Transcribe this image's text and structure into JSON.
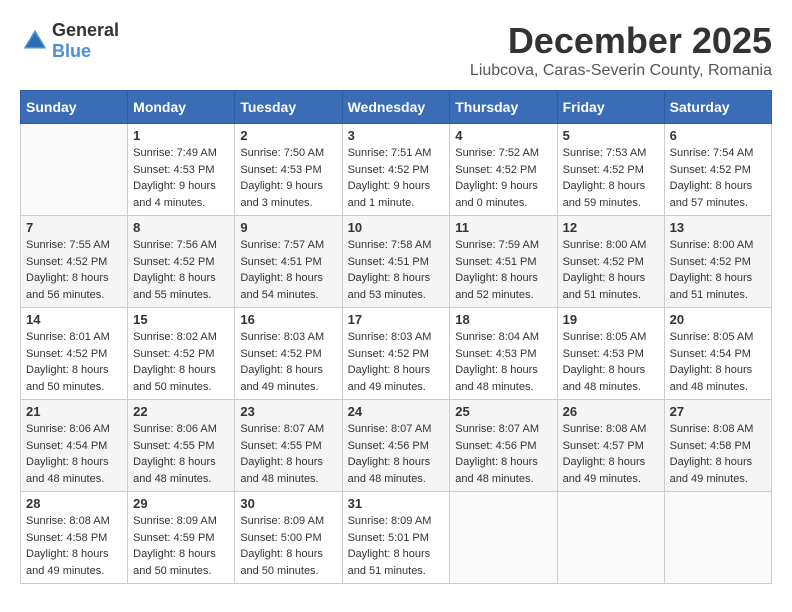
{
  "logo": {
    "text_general": "General",
    "text_blue": "Blue"
  },
  "header": {
    "month": "December 2025",
    "location": "Liubcova, Caras-Severin County, Romania"
  },
  "weekdays": [
    "Sunday",
    "Monday",
    "Tuesday",
    "Wednesday",
    "Thursday",
    "Friday",
    "Saturday"
  ],
  "weeks": [
    [
      {
        "day": "",
        "info": ""
      },
      {
        "day": "1",
        "info": "Sunrise: 7:49 AM\nSunset: 4:53 PM\nDaylight: 9 hours\nand 4 minutes."
      },
      {
        "day": "2",
        "info": "Sunrise: 7:50 AM\nSunset: 4:53 PM\nDaylight: 9 hours\nand 3 minutes."
      },
      {
        "day": "3",
        "info": "Sunrise: 7:51 AM\nSunset: 4:52 PM\nDaylight: 9 hours\nand 1 minute."
      },
      {
        "day": "4",
        "info": "Sunrise: 7:52 AM\nSunset: 4:52 PM\nDaylight: 9 hours\nand 0 minutes."
      },
      {
        "day": "5",
        "info": "Sunrise: 7:53 AM\nSunset: 4:52 PM\nDaylight: 8 hours\nand 59 minutes."
      },
      {
        "day": "6",
        "info": "Sunrise: 7:54 AM\nSunset: 4:52 PM\nDaylight: 8 hours\nand 57 minutes."
      }
    ],
    [
      {
        "day": "7",
        "info": "Sunrise: 7:55 AM\nSunset: 4:52 PM\nDaylight: 8 hours\nand 56 minutes."
      },
      {
        "day": "8",
        "info": "Sunrise: 7:56 AM\nSunset: 4:52 PM\nDaylight: 8 hours\nand 55 minutes."
      },
      {
        "day": "9",
        "info": "Sunrise: 7:57 AM\nSunset: 4:51 PM\nDaylight: 8 hours\nand 54 minutes."
      },
      {
        "day": "10",
        "info": "Sunrise: 7:58 AM\nSunset: 4:51 PM\nDaylight: 8 hours\nand 53 minutes."
      },
      {
        "day": "11",
        "info": "Sunrise: 7:59 AM\nSunset: 4:51 PM\nDaylight: 8 hours\nand 52 minutes."
      },
      {
        "day": "12",
        "info": "Sunrise: 8:00 AM\nSunset: 4:52 PM\nDaylight: 8 hours\nand 51 minutes."
      },
      {
        "day": "13",
        "info": "Sunrise: 8:00 AM\nSunset: 4:52 PM\nDaylight: 8 hours\nand 51 minutes."
      }
    ],
    [
      {
        "day": "14",
        "info": "Sunrise: 8:01 AM\nSunset: 4:52 PM\nDaylight: 8 hours\nand 50 minutes."
      },
      {
        "day": "15",
        "info": "Sunrise: 8:02 AM\nSunset: 4:52 PM\nDaylight: 8 hours\nand 50 minutes."
      },
      {
        "day": "16",
        "info": "Sunrise: 8:03 AM\nSunset: 4:52 PM\nDaylight: 8 hours\nand 49 minutes."
      },
      {
        "day": "17",
        "info": "Sunrise: 8:03 AM\nSunset: 4:52 PM\nDaylight: 8 hours\nand 49 minutes."
      },
      {
        "day": "18",
        "info": "Sunrise: 8:04 AM\nSunset: 4:53 PM\nDaylight: 8 hours\nand 48 minutes."
      },
      {
        "day": "19",
        "info": "Sunrise: 8:05 AM\nSunset: 4:53 PM\nDaylight: 8 hours\nand 48 minutes."
      },
      {
        "day": "20",
        "info": "Sunrise: 8:05 AM\nSunset: 4:54 PM\nDaylight: 8 hours\nand 48 minutes."
      }
    ],
    [
      {
        "day": "21",
        "info": "Sunrise: 8:06 AM\nSunset: 4:54 PM\nDaylight: 8 hours\nand 48 minutes."
      },
      {
        "day": "22",
        "info": "Sunrise: 8:06 AM\nSunset: 4:55 PM\nDaylight: 8 hours\nand 48 minutes."
      },
      {
        "day": "23",
        "info": "Sunrise: 8:07 AM\nSunset: 4:55 PM\nDaylight: 8 hours\nand 48 minutes."
      },
      {
        "day": "24",
        "info": "Sunrise: 8:07 AM\nSunset: 4:56 PM\nDaylight: 8 hours\nand 48 minutes."
      },
      {
        "day": "25",
        "info": "Sunrise: 8:07 AM\nSunset: 4:56 PM\nDaylight: 8 hours\nand 48 minutes."
      },
      {
        "day": "26",
        "info": "Sunrise: 8:08 AM\nSunset: 4:57 PM\nDaylight: 8 hours\nand 49 minutes."
      },
      {
        "day": "27",
        "info": "Sunrise: 8:08 AM\nSunset: 4:58 PM\nDaylight: 8 hours\nand 49 minutes."
      }
    ],
    [
      {
        "day": "28",
        "info": "Sunrise: 8:08 AM\nSunset: 4:58 PM\nDaylight: 8 hours\nand 49 minutes."
      },
      {
        "day": "29",
        "info": "Sunrise: 8:09 AM\nSunset: 4:59 PM\nDaylight: 8 hours\nand 50 minutes."
      },
      {
        "day": "30",
        "info": "Sunrise: 8:09 AM\nSunset: 5:00 PM\nDaylight: 8 hours\nand 50 minutes."
      },
      {
        "day": "31",
        "info": "Sunrise: 8:09 AM\nSunset: 5:01 PM\nDaylight: 8 hours\nand 51 minutes."
      },
      {
        "day": "",
        "info": ""
      },
      {
        "day": "",
        "info": ""
      },
      {
        "day": "",
        "info": ""
      }
    ]
  ]
}
